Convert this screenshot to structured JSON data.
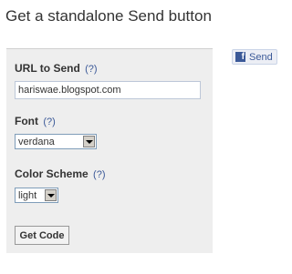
{
  "page": {
    "title": "Get a standalone Send button"
  },
  "form": {
    "url_label": "URL to Send",
    "url_help": "(?)",
    "url_value": "hariswae.blogspot.com",
    "font_label": "Font",
    "font_help": "(?)",
    "font_value": "verdana",
    "color_label": "Color Scheme",
    "color_help": "(?)",
    "color_value": "light",
    "get_code_label": "Get Code"
  },
  "preview": {
    "send_label": "Send",
    "icon": "facebook-icon"
  },
  "colors": {
    "link": "#3b5998",
    "panel_bg": "#eeeeee"
  }
}
